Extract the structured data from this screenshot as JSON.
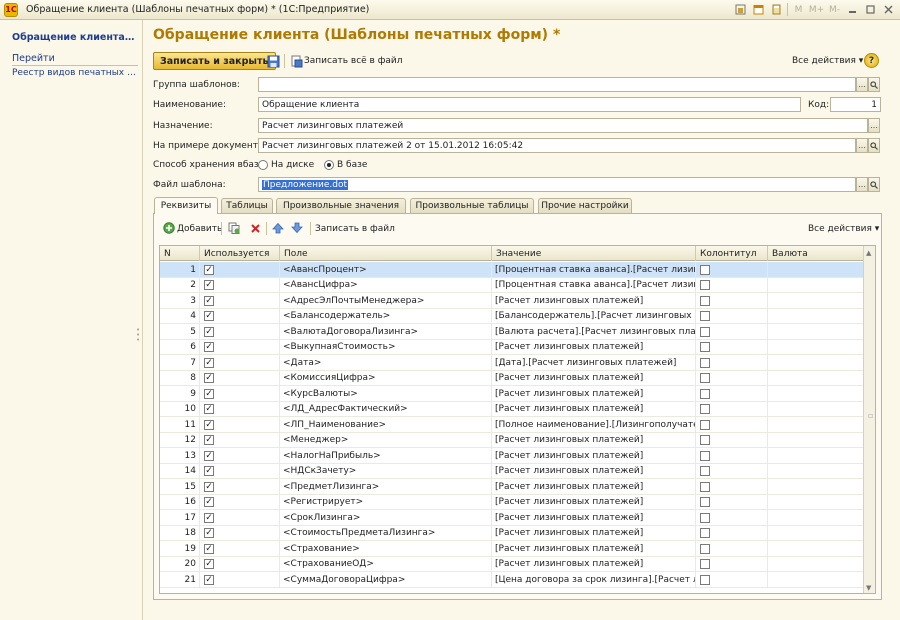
{
  "window": {
    "title": "Обращение клиента (Шаблоны печатных форм) * (1С:Предприятие)",
    "logo_text": "1С",
    "toolbar_icons": [
      "home-icon",
      "calendar-icon",
      "calculator-icon",
      "m-button",
      "m-plus-button",
      "m-minus-button",
      "minimize-icon",
      "maximize-icon",
      "close-icon"
    ],
    "toolbar_labels": [
      "M",
      "M+",
      "M-"
    ]
  },
  "left_panel": {
    "active_item": "Обращение клиента (Шаблоны печатных форм)",
    "group_title": "Перейти",
    "links": [
      "Реестр видов печатных документов"
    ]
  },
  "form": {
    "title": "Обращение клиента (Шаблоны печатных форм) *",
    "toolbar": {
      "save_close_label": "Записать и закрыть",
      "write_all_label": "Записать всё в файл",
      "all_actions_label": "Все действия",
      "help_label": "?"
    },
    "fields": {
      "group_label": "Группа шаблонов:",
      "group_value": "",
      "name_label": "Наименование:",
      "name_value": "Обращение клиента",
      "code_label": "Код:",
      "code_value": "1",
      "purpose_label": "Назначение:",
      "purpose_value": "Расчет лизинговых платежей",
      "example_label": "На примере документа:",
      "example_value": "Расчет лизинговых платежей 2 от 15.01.2012 16:05:42",
      "storage_label": "Способ хранения вбазе:",
      "storage_options": [
        "На диске",
        "В базе"
      ],
      "storage_selected": "В базе",
      "file_label": "Файл шаблона:",
      "file_value": "Предложение.dot"
    },
    "tabs": [
      "Реквизиты",
      "Таблицы",
      "Произвольные значения",
      "Произвольные таблицы",
      "Прочие настройки"
    ],
    "active_tab": "Реквизиты",
    "tab_toolbar": {
      "add_label": "Добавить",
      "write_file_label": "Записать в файл",
      "all_actions_label": "Все действия"
    },
    "table": {
      "columns": [
        "N",
        "Используется",
        "Поле",
        "Значение",
        "Колонтитул",
        "Валюта"
      ],
      "selected_row": 1,
      "rows": [
        {
          "n": "1",
          "used": true,
          "field": "<АвансПроцент>",
          "value": "[Процентная ставка аванса].[Расчет лизинг...",
          "footer": false,
          "currency": ""
        },
        {
          "n": "2",
          "used": true,
          "field": "<АвансЦифра>",
          "value": "[Процентная ставка аванса].[Расчет лизинг...",
          "footer": false,
          "currency": ""
        },
        {
          "n": "3",
          "used": true,
          "field": "<АдресЭлПочтыМенеджера>",
          "value": "[Расчет лизинговых платежей]",
          "footer": false,
          "currency": ""
        },
        {
          "n": "4",
          "used": true,
          "field": "<Балансодержатель>",
          "value": "[Балансодержатель].[Расчет лизинговых пл...",
          "footer": false,
          "currency": ""
        },
        {
          "n": "5",
          "used": true,
          "field": "<ВалютаДоговораЛизинга>",
          "value": "[Валюта расчета].[Расчет лизинговых плате...",
          "footer": false,
          "currency": ""
        },
        {
          "n": "6",
          "used": true,
          "field": "<ВыкупнаяСтоимость>",
          "value": "[Расчет лизинговых платежей]",
          "footer": false,
          "currency": ""
        },
        {
          "n": "7",
          "used": true,
          "field": "<Дата>",
          "value": "[Дата].[Расчет лизинговых платежей]",
          "footer": false,
          "currency": ""
        },
        {
          "n": "8",
          "used": true,
          "field": "<КомиссияЦифра>",
          "value": "[Расчет лизинговых платежей]",
          "footer": false,
          "currency": ""
        },
        {
          "n": "9",
          "used": true,
          "field": "<КурсВалюты>",
          "value": "[Расчет лизинговых платежей]",
          "footer": false,
          "currency": ""
        },
        {
          "n": "10",
          "used": true,
          "field": "<ЛД_АдресФактический>",
          "value": "[Расчет лизинговых платежей]",
          "footer": false,
          "currency": ""
        },
        {
          "n": "11",
          "used": true,
          "field": "<ЛП_Наименование>",
          "value": "[Полное наименование].[Лизингополучатель...",
          "footer": false,
          "currency": ""
        },
        {
          "n": "12",
          "used": true,
          "field": "<Менеджер>",
          "value": "[Расчет лизинговых платежей]",
          "footer": false,
          "currency": ""
        },
        {
          "n": "13",
          "used": true,
          "field": "<НалогНаПрибыль>",
          "value": "[Расчет лизинговых платежей]",
          "footer": false,
          "currency": ""
        },
        {
          "n": "14",
          "used": true,
          "field": "<НДСкЗачету>",
          "value": "[Расчет лизинговых платежей]",
          "footer": false,
          "currency": ""
        },
        {
          "n": "15",
          "used": true,
          "field": "<ПредметЛизинга>",
          "value": "[Расчет лизинговых платежей]",
          "footer": false,
          "currency": ""
        },
        {
          "n": "16",
          "used": true,
          "field": "<Регистрирует>",
          "value": "[Расчет лизинговых платежей]",
          "footer": false,
          "currency": ""
        },
        {
          "n": "17",
          "used": true,
          "field": "<СрокЛизинга>",
          "value": "[Расчет лизинговых платежей]",
          "footer": false,
          "currency": ""
        },
        {
          "n": "18",
          "used": true,
          "field": "<СтоимостьПредметаЛизинга>",
          "value": "[Расчет лизинговых платежей]",
          "footer": false,
          "currency": ""
        },
        {
          "n": "19",
          "used": true,
          "field": "<Страхование>",
          "value": "[Расчет лизинговых платежей]",
          "footer": false,
          "currency": ""
        },
        {
          "n": "20",
          "used": true,
          "field": "<СтрахованиеОД>",
          "value": "[Расчет лизинговых платежей]",
          "footer": false,
          "currency": ""
        },
        {
          "n": "21",
          "used": true,
          "field": "<СуммаДоговораЦифра>",
          "value": "[Цена договора за срок лизинга].[Расчет ли...",
          "footer": false,
          "currency": ""
        }
      ]
    }
  },
  "colors": {
    "accent_title": "#b07a00",
    "link_blue": "#1e3c8c",
    "selection": "#cfe3f8",
    "primary_button": "#e8b830",
    "background": "#fbf8ea"
  }
}
